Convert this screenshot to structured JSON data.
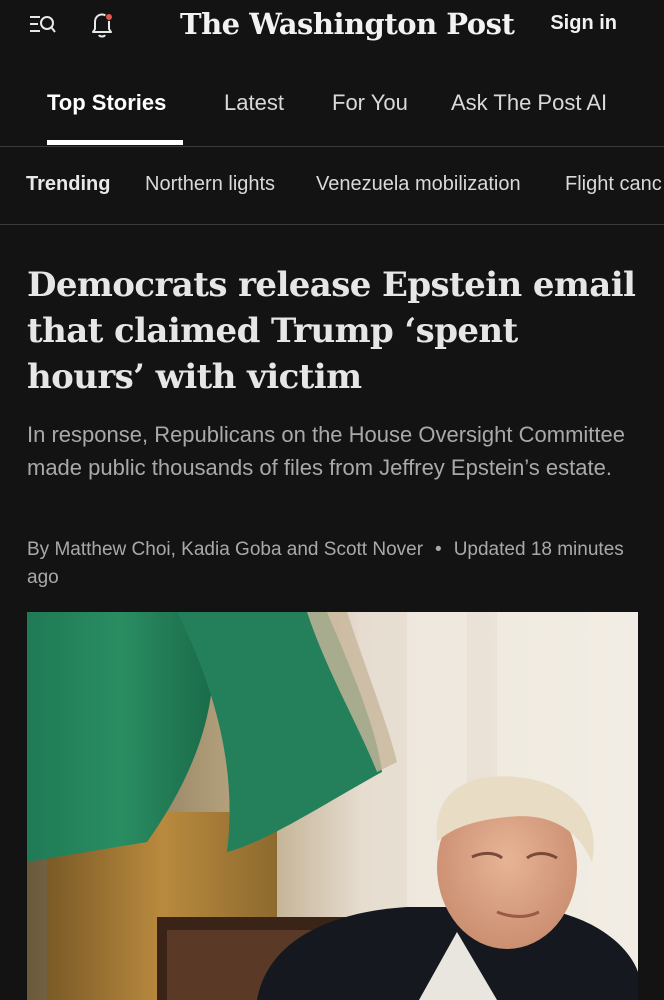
{
  "header": {
    "masthead": "The Washington Post",
    "sign_in": "Sign in",
    "icons": [
      "menu-search-icon",
      "bell-icon"
    ],
    "notification_dot_color": "#e4574e"
  },
  "tabs": [
    {
      "label": "Top Stories",
      "active": true
    },
    {
      "label": "Latest",
      "active": false
    },
    {
      "label": "For You",
      "active": false
    },
    {
      "label": "Ask The Post AI",
      "active": false
    }
  ],
  "trending": {
    "label": "Trending",
    "items": [
      "Northern lights",
      "Venezuela mobilization",
      "Flight canc"
    ]
  },
  "article": {
    "headline": "Democrats release Epstein email that claimed Trump ‘spent hours’ with victim",
    "summary": "In response, Republicans on the House Oversight Committee made public thousands of files from Jeffrey Epstein’s estate.",
    "byline": "By Matthew Choi, Kadia Goba and Scott Nover",
    "updated": "Updated 18 minutes ago"
  },
  "colors": {
    "background": "#131313",
    "text_primary": "#e6e6e6",
    "text_secondary": "#a9a9a9",
    "divider": "#3a3a3a"
  }
}
